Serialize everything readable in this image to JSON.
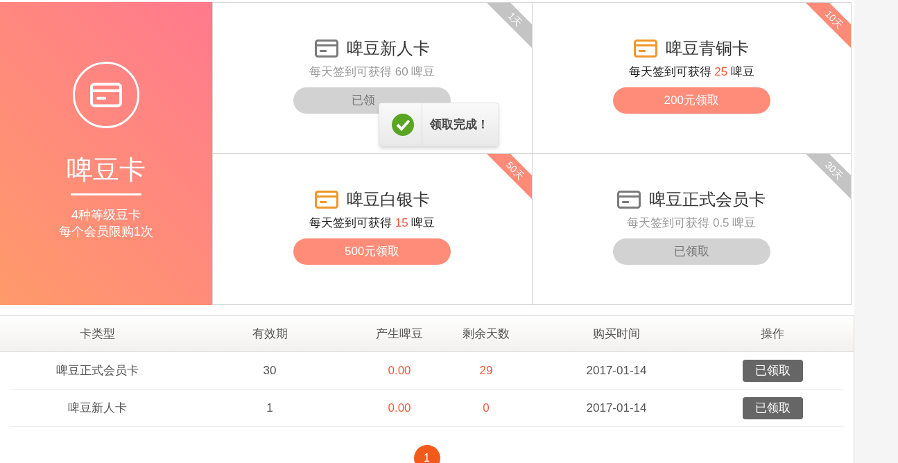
{
  "hero": {
    "title": "啤豆卡",
    "lines": [
      "4种等级豆卡",
      "每个会员限购1次"
    ]
  },
  "cards": [
    {
      "title": "啤豆新人卡",
      "claimed": true,
      "ribbon": "1天",
      "desc_before": "每天签到可获得",
      "amount": "60",
      "desc_after": "啤豆",
      "button": "已领"
    },
    {
      "title": "啤豆青铜卡",
      "claimed": false,
      "ribbon": "10天",
      "desc_before": "每天签到可获得",
      "amount": "25",
      "desc_after": "啤豆",
      "button": "200元领取"
    },
    {
      "title": "啤豆白银卡",
      "claimed": false,
      "ribbon": "50天",
      "desc_before": "每天签到可获得",
      "amount": "15",
      "desc_after": "啤豆",
      "button": "500元领取"
    },
    {
      "title": "啤豆正式会员卡",
      "claimed": true,
      "ribbon": "30天",
      "desc_before": "每天签到可获得",
      "amount": "0.5",
      "desc_after": "啤豆",
      "button": "已领取"
    }
  ],
  "toast": {
    "message": "领取完成！"
  },
  "table": {
    "columns": [
      "卡类型",
      "有效期",
      "产生啤豆",
      "剩余天数",
      "购买时间",
      "操作"
    ],
    "rows": [
      {
        "type": "啤豆正式会员卡",
        "validity": "30",
        "beans": "0.00",
        "days_left": "29",
        "purchased": "2017-01-14",
        "action": "已领取"
      },
      {
        "type": "啤豆新人卡",
        "validity": "1",
        "beans": "0.00",
        "days_left": "0",
        "purchased": "2017-01-14",
        "action": "已领取"
      }
    ]
  },
  "pagination": {
    "pages": [
      {
        "label": "1",
        "selected": true
      }
    ]
  }
}
